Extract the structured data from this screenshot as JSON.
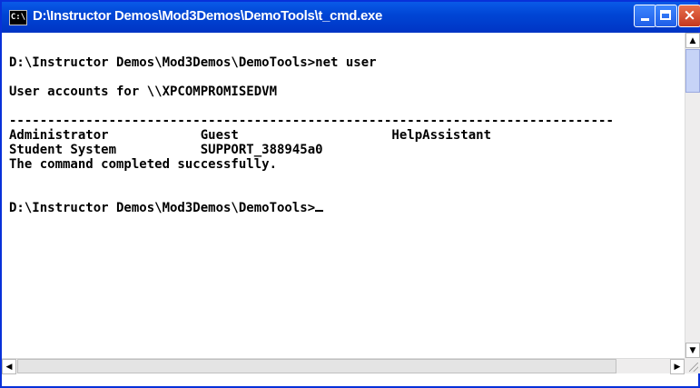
{
  "window": {
    "title": "D:\\Instructor Demos\\Mod3Demos\\DemoTools\\t_cmd.exe",
    "icon_text": "C:\\",
    "buttons": {
      "minimize": "minimize-icon",
      "maximize": "maximize-icon",
      "close": "close-icon"
    }
  },
  "console": {
    "lines": [
      "",
      "D:\\Instructor Demos\\Mod3Demos\\DemoTools>net user",
      "",
      "User accounts for \\\\XPCOMPROMISEDVM",
      "",
      "-------------------------------------------------------------------------------",
      "Administrator            Guest                    HelpAssistant",
      "Student System           SUPPORT_388945a0",
      "The command completed successfully.",
      "",
      "",
      "D:\\Instructor Demos\\Mod3Demos\\DemoTools>"
    ]
  },
  "scrollbars": {
    "up_arrow": "▲",
    "down_arrow": "▼",
    "left_arrow": "◀",
    "right_arrow": "▶"
  },
  "colors": {
    "titlebar": "#0046d5",
    "close": "#c4381f",
    "text": "#000000",
    "background": "#ffffff"
  }
}
